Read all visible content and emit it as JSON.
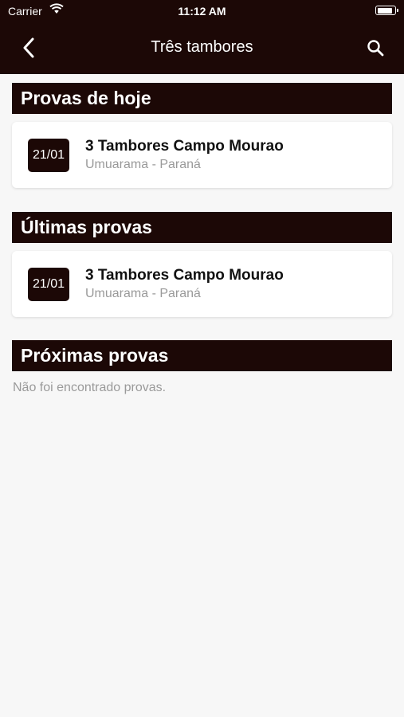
{
  "status_bar": {
    "carrier": "Carrier",
    "time": "11:12 AM"
  },
  "nav": {
    "title": "Três tambores",
    "back_icon": "chevron-left-icon",
    "search_icon": "search-icon"
  },
  "sections": [
    {
      "title": "Provas de hoje",
      "items": [
        {
          "date": "21/01",
          "name": "3 Tambores Campo Mourao",
          "location": "Umuarama - Paraná"
        }
      ]
    },
    {
      "title": "Últimas provas",
      "items": [
        {
          "date": "21/01",
          "name": "3 Tambores Campo Mourao",
          "location": "Umuarama - Paraná"
        }
      ]
    },
    {
      "title": "Próximas provas",
      "empty_message": "Não foi encontrado provas."
    }
  ],
  "colors": {
    "brand": "#1c0806",
    "background": "#f7f7f7",
    "secondary_text": "#9a9a9a"
  }
}
